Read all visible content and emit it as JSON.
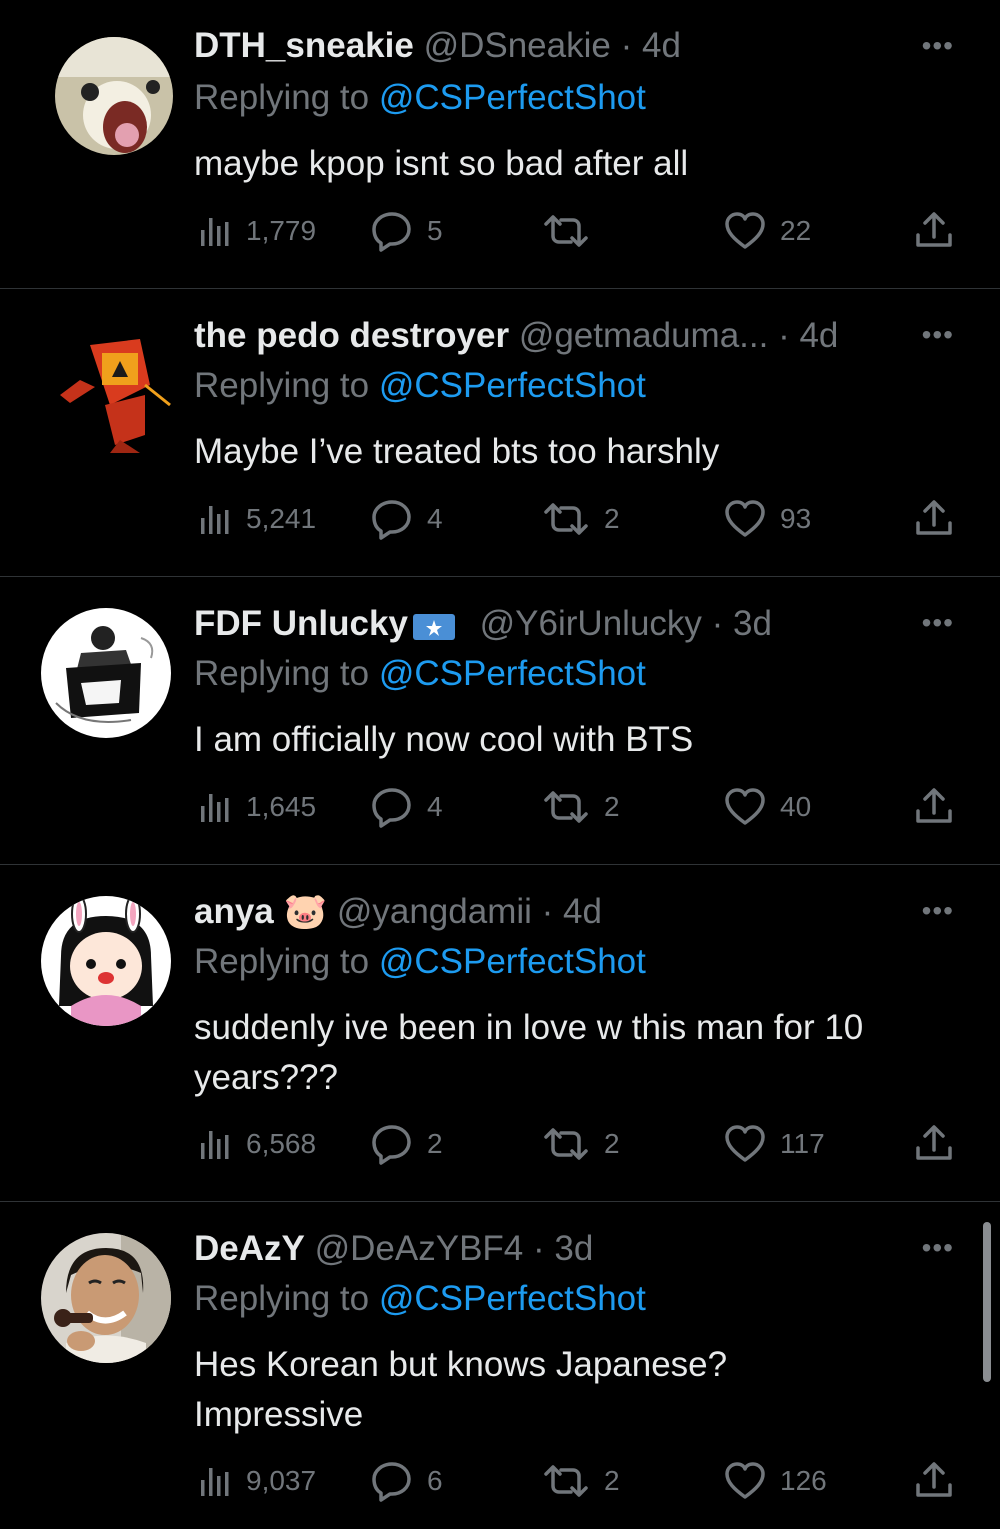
{
  "tweets": [
    {
      "name": "DTH_sneakie",
      "handle": "@DSneakie",
      "dot": "·",
      "time": "4d",
      "replying_prefix": "Replying to ",
      "replying_to": "@CSPerfectShot",
      "text": "maybe kpop isnt so bad after all",
      "views": "1,779",
      "replies": "5",
      "retweets": "",
      "likes": "22",
      "more": "•••"
    },
    {
      "name": "the pedo destroyer",
      "handle": "@getmaduma...",
      "dot": "·",
      "time": "4d",
      "replying_prefix": "Replying to ",
      "replying_to": "@CSPerfectShot",
      "text": "Maybe I’ve treated bts too harshly",
      "views": "5,241",
      "replies": "4",
      "retweets": "2",
      "likes": "93",
      "more": "•••"
    },
    {
      "name": "FDF Unlucky",
      "handle": "@Y6irUnlucky",
      "dot": "·",
      "time": "3d",
      "replying_prefix": "Replying to ",
      "replying_to": "@CSPerfectShot",
      "text": "I am officially now cool with BTS",
      "views": "1,645",
      "replies": "4",
      "retweets": "2",
      "likes": "40",
      "more": "•••"
    },
    {
      "name": "anya",
      "emoji": "🐷",
      "handle": "@yangdamii",
      "dot": "·",
      "time": "4d",
      "replying_prefix": "Replying to ",
      "replying_to": "@CSPerfectShot",
      "text": "suddenly ive been in love w this man for 10 years???",
      "views": "6,568",
      "replies": "2",
      "retweets": "2",
      "likes": "117",
      "more": "•••"
    },
    {
      "name": "DeAzY",
      "handle": "@DeAzYBF4",
      "dot": "·",
      "time": "3d",
      "replying_prefix": "Replying to ",
      "replying_to": "@CSPerfectShot",
      "text": "Hes Korean but knows Japanese? Impressive",
      "views": "9,037",
      "replies": "6",
      "retweets": "2",
      "likes": "126",
      "more": "•••"
    }
  ],
  "colors": {
    "background": "#000000",
    "text": "#e7e9ea",
    "secondary": "#71767b",
    "link": "#1d9bf0",
    "divider": "#2f3336"
  },
  "icons": [
    "views-icon",
    "reply-icon",
    "retweet-icon",
    "like-icon",
    "share-icon",
    "more-icon"
  ]
}
